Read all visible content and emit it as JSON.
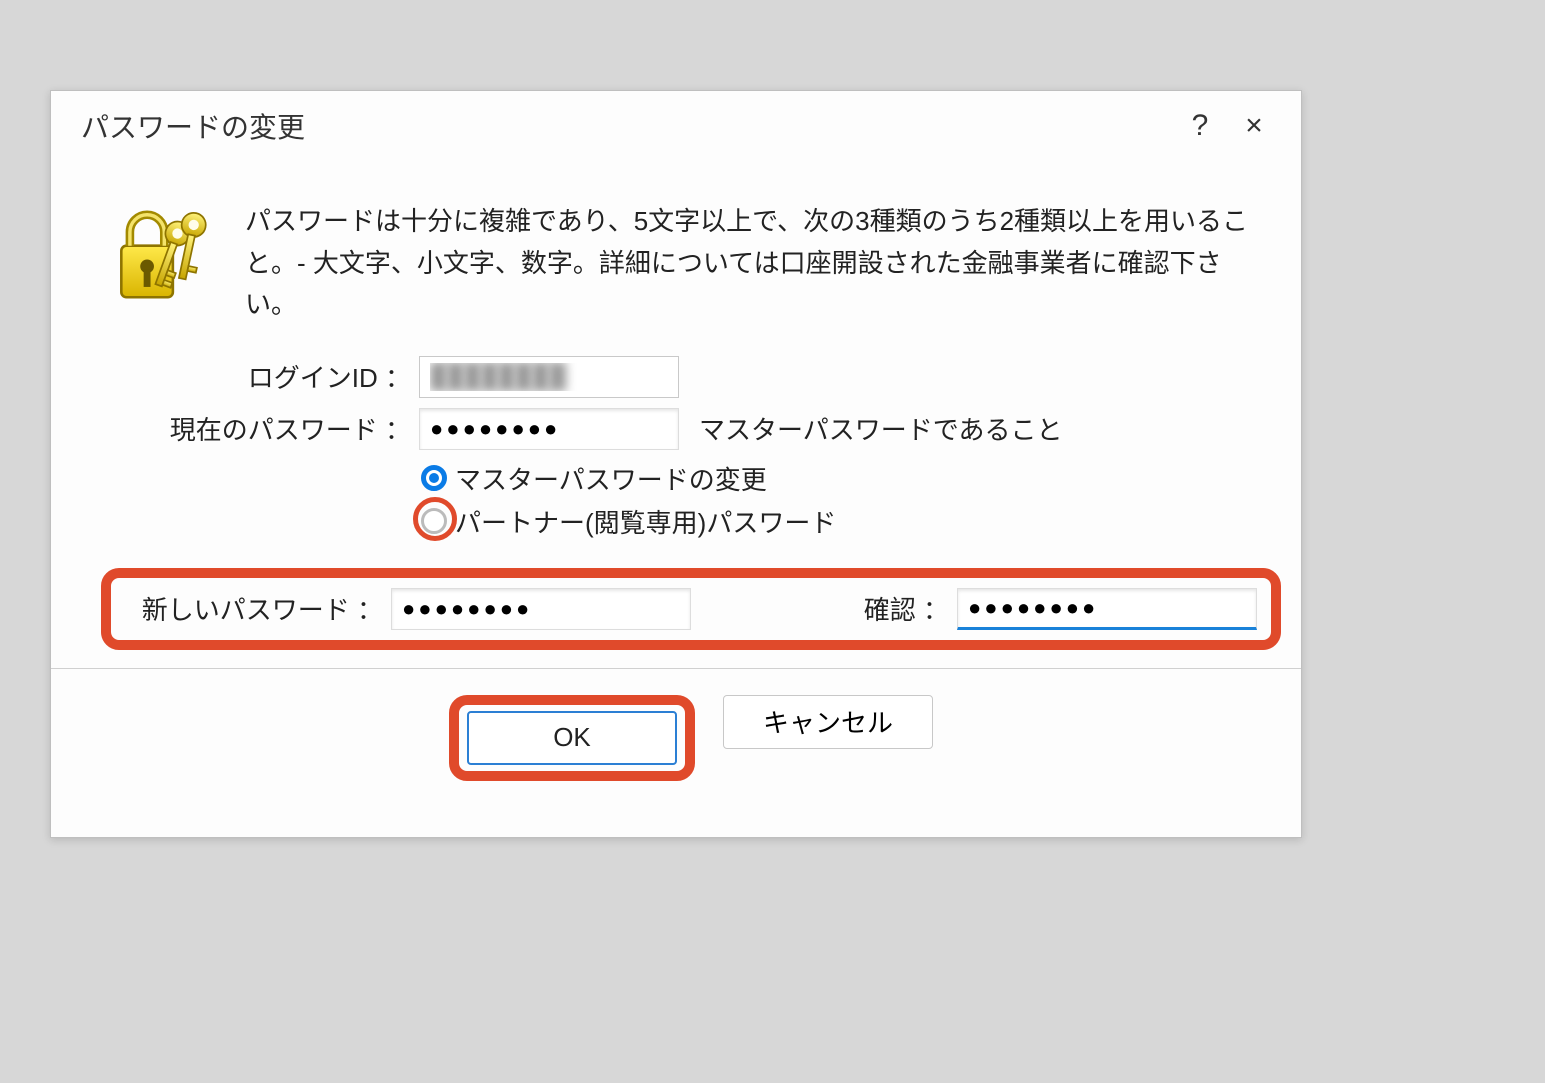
{
  "dialog": {
    "title": "パスワードの変更",
    "help_button": "?",
    "close_button": "×",
    "intro_text": "パスワードは十分に複雑であり、5文字以上で、次の3種類のうち2種類以上を用いること。- 大文字、小文字、数字。詳細については口座開設された金融事業者に確認下さい。",
    "login": {
      "label": "ログインID ：",
      "value": "████████"
    },
    "current_password": {
      "label": "現在のパスワード ：",
      "value": "●●●●●●●●",
      "hint": "マスターパスワードであること"
    },
    "radio": {
      "master_label": "マスターパスワードの変更",
      "partner_label": "パートナー(閲覧専用)パスワード",
      "selected": "master"
    },
    "new_password": {
      "label": "新しいパスワード ：",
      "value": "●●●●●●●●"
    },
    "confirm_password": {
      "label": "確認 ：",
      "value": "●●●●●●●●"
    },
    "buttons": {
      "ok": "OK",
      "cancel": "キャンセル"
    }
  }
}
